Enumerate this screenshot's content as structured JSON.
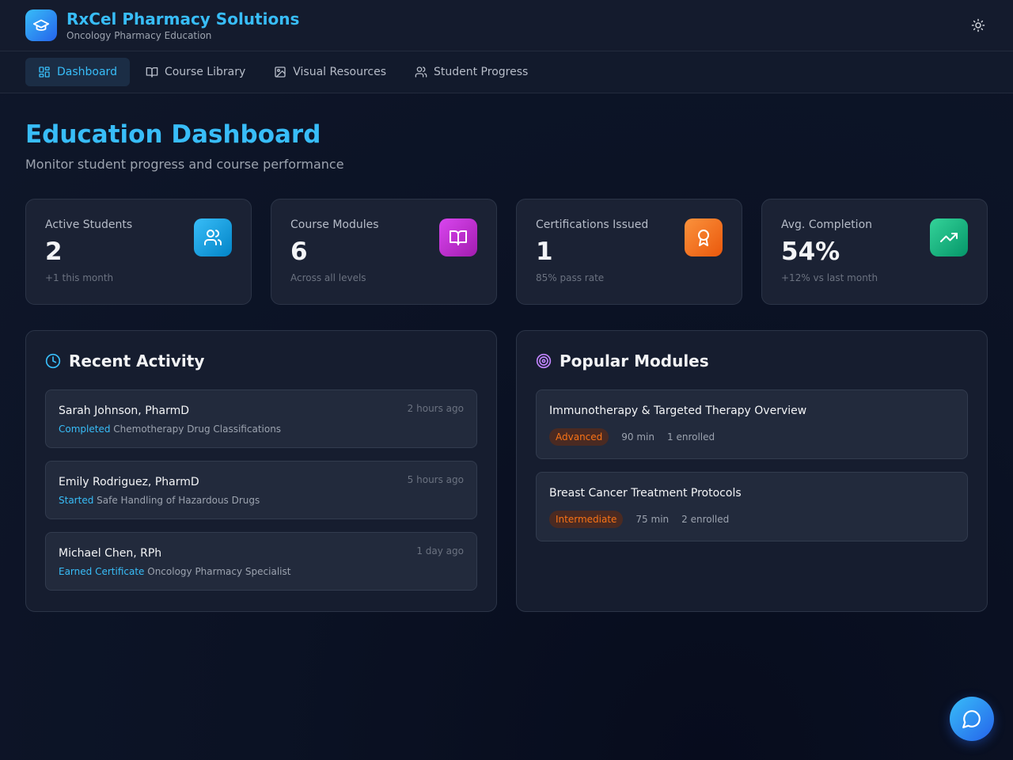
{
  "app": {
    "title": "RxCel Pharmacy Solutions",
    "subtitle": "Oncology Pharmacy Education"
  },
  "nav": [
    {
      "label": "Dashboard",
      "icon": "grid-icon",
      "active": true
    },
    {
      "label": "Course Library",
      "icon": "book-open-icon",
      "active": false
    },
    {
      "label": "Visual Resources",
      "icon": "image-icon",
      "active": false
    },
    {
      "label": "Student Progress",
      "icon": "users-icon",
      "active": false
    }
  ],
  "page": {
    "title": "Education Dashboard",
    "subtitle": "Monitor student progress and course performance"
  },
  "stats": [
    {
      "label": "Active Students",
      "value": "2",
      "note": "+1 this month",
      "icon": "users-icon",
      "color": "#0ea5e9"
    },
    {
      "label": "Course Modules",
      "value": "6",
      "note": "Across all levels",
      "icon": "book-open-icon",
      "color": "#c026d3"
    },
    {
      "label": "Certifications Issued",
      "value": "1",
      "note": "85% pass rate",
      "icon": "award-icon",
      "color": "#f97316"
    },
    {
      "label": "Avg. Completion",
      "value": "54%",
      "note": "+12% vs last month",
      "icon": "trending-up-icon",
      "color": "#10b981"
    }
  ],
  "recent_activity": {
    "title": "Recent Activity",
    "items": [
      {
        "name": "Sarah Johnson, PharmD",
        "time": "2 hours ago",
        "verb": "Completed",
        "target": "Chemotherapy Drug Classifications"
      },
      {
        "name": "Emily Rodriguez, PharmD",
        "time": "5 hours ago",
        "verb": "Started",
        "target": "Safe Handling of Hazardous Drugs"
      },
      {
        "name": "Michael Chen, RPh",
        "time": "1 day ago",
        "verb": "Earned Certificate",
        "target": "Oncology Pharmacy Specialist"
      }
    ]
  },
  "popular_modules": {
    "title": "Popular Modules",
    "items": [
      {
        "title": "Immunotherapy & Targeted Therapy Overview",
        "level": "Advanced",
        "duration": "90 min",
        "enrolled": "1 enrolled"
      },
      {
        "title": "Breast Cancer Treatment Protocols",
        "level": "Intermediate",
        "duration": "75 min",
        "enrolled": "2 enrolled"
      }
    ]
  },
  "colors": {
    "accent": "#38bdf8",
    "badge": "#f97316"
  }
}
